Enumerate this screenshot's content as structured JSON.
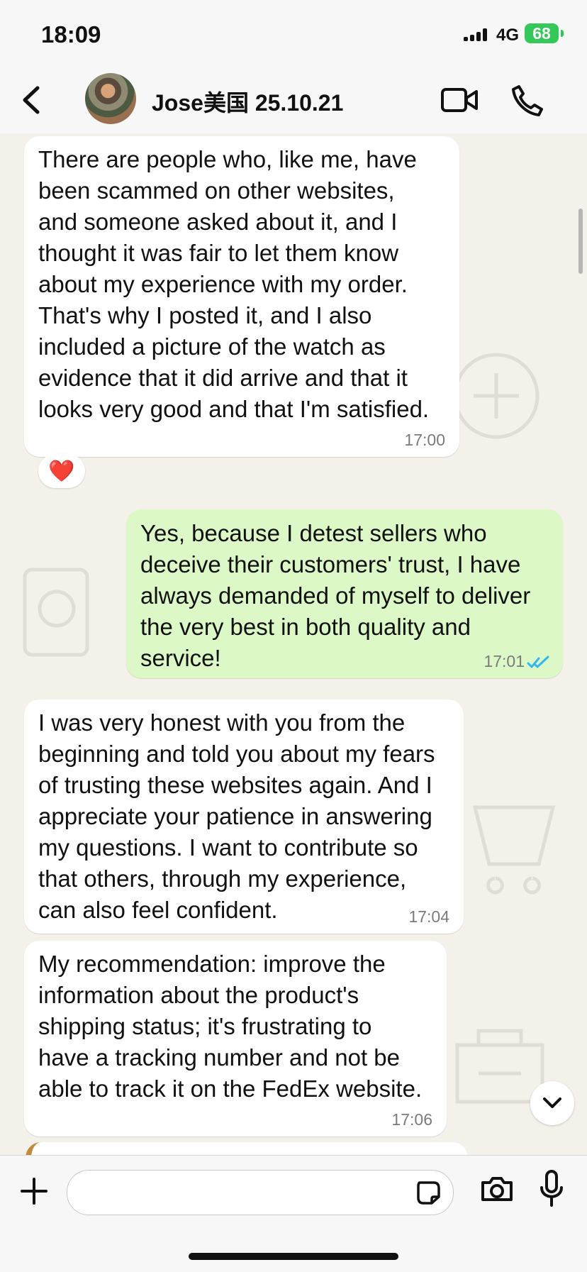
{
  "status_bar": {
    "time": "18:09",
    "network": "4G",
    "battery": "68"
  },
  "header": {
    "contact_name": "Jose美国 25.10.21"
  },
  "messages": [
    {
      "direction": "incoming",
      "text": "There are people who, like me, have\nbeen scammed on other websites,\nand someone asked about it, and I\nthought it was fair to let them know\nabout my experience with my order.\nThat's why I posted it, and I also\nincluded a picture of the watch as\nevidence that it did arrive and that it\nlooks very good and that I'm satisfied.",
      "time": "17:00",
      "reaction": "❤️"
    },
    {
      "direction": "outgoing",
      "text": "Yes, because I detest sellers who\ndeceive their customers' trust, I have\nalways demanded of myself to deliver\nthe very best in both quality and\nservice!",
      "time": "17:01"
    },
    {
      "direction": "incoming",
      "text": "I was very honest with you from the\nbeginning and told you about my fears\nof trusting these websites again. And I\nappreciate your patience in answering\nmy questions. I want to contribute so\nthat others, through my experience,\ncan also feel confident.",
      "time": "17:04"
    },
    {
      "direction": "incoming",
      "text": "My recommendation: improve the\ninformation about the product's\nshipping status; it's frustrating to\nhave a tracking number and not be\nable to track it on the FedEx website.",
      "time": "17:06"
    }
  ],
  "composer": {
    "placeholder": ""
  },
  "icons": {
    "back": "chevron-left-icon",
    "video": "video-camera-icon",
    "phone": "phone-icon",
    "plus": "plus-icon",
    "sticker": "sticker-icon",
    "camera": "camera-icon",
    "mic": "microphone-icon",
    "scroll": "chevron-down-icon"
  },
  "colors": {
    "incoming_bubble": "#ffffff",
    "outgoing_bubble": "#dcf8c6",
    "read_receipt": "#34b7f1",
    "battery": "#34c759"
  }
}
